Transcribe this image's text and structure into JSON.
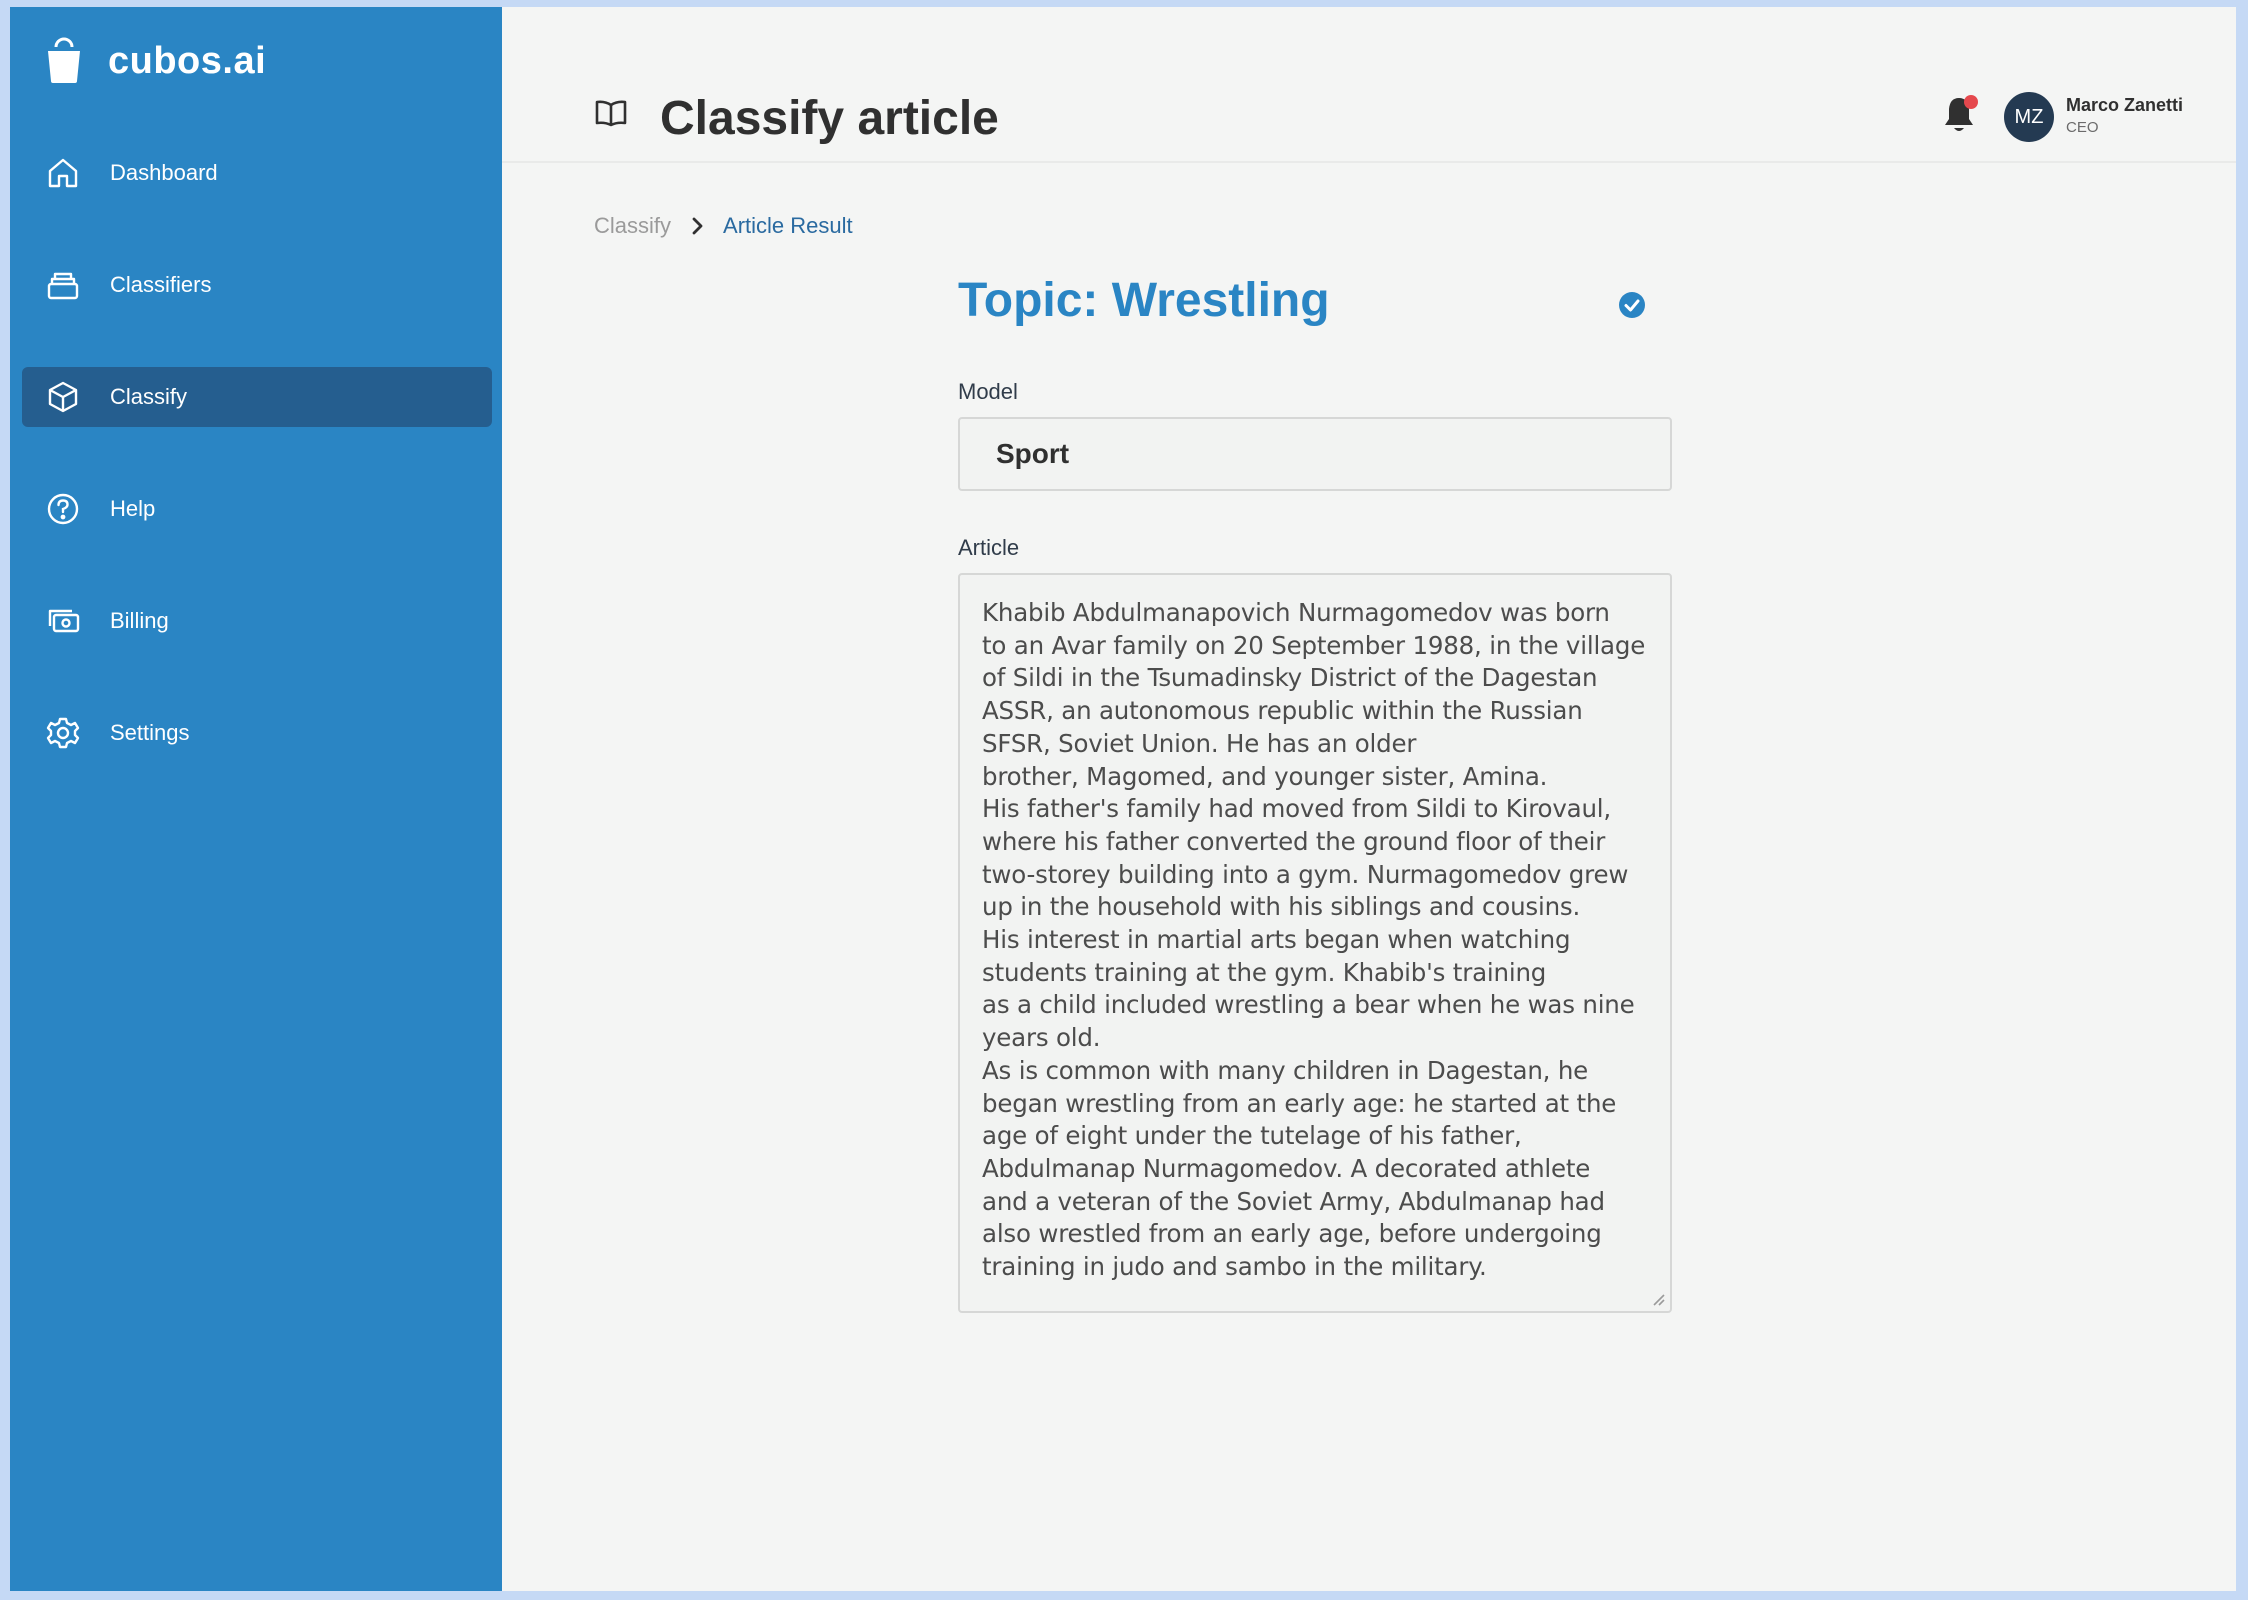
{
  "brand": {
    "name": "cubos.ai",
    "icon": "bucket-logo-icon"
  },
  "sidebar": {
    "items": [
      {
        "label": "Dashboard",
        "icon": "home-icon",
        "active": false
      },
      {
        "label": "Classifiers",
        "icon": "layers-icon",
        "active": false
      },
      {
        "label": "Classify",
        "icon": "cube-icon",
        "active": true
      },
      {
        "label": "Help",
        "icon": "help-circle-icon",
        "active": false
      },
      {
        "label": "Billing",
        "icon": "billing-icon",
        "active": false
      },
      {
        "label": "Settings",
        "icon": "gear-icon",
        "active": false
      }
    ]
  },
  "header": {
    "title": "Classify article",
    "icon": "book-icon",
    "notifications": {
      "icon": "bell-icon",
      "has_unread": true
    },
    "user": {
      "initials": "MZ",
      "name": "Marco Zanetti",
      "role": "CEO"
    }
  },
  "breadcrumb": {
    "items": [
      "Classify",
      "Article Result"
    ]
  },
  "result": {
    "topic": "Topic: Wrestling",
    "model_label": "Model",
    "model_value": "Sport",
    "article_label": "Article",
    "article_lines": [
      "Khabib Abdulmanapovich Nurmagomedov was born",
      "to an Avar family on 20 September 1988, in the village",
      "of Sildi in the Tsumadinsky District of the Dagestan",
      "ASSR, an autonomous republic within the Russian",
      "SFSR, Soviet Union. He has an older",
      "brother, Magomed, and younger sister, Amina.",
      "His father's family had moved from Sildi to Kirovaul,",
      "where his father converted the ground floor of their",
      "two-storey building into a gym. Nurmagomedov grew",
      "up in the household with his siblings and cousins.",
      "His interest in martial arts began when watching",
      "students training at the gym. Khabib's training",
      "as a child included wrestling a bear when he was nine",
      "years old.",
      "As is common with many children in Dagestan, he",
      "began wrestling from an early age: he started at the",
      "age of eight under the tutelage of his father,",
      "Abdulmanap Nurmagomedov. A decorated athlete",
      "and a veteran of the Soviet Army, Abdulmanap had",
      "also wrestled from an early age, before undergoing",
      "training in judo and sambo in the military."
    ]
  },
  "colors": {
    "sidebar": "#2a85c4",
    "sidebar_active": "#255e8f",
    "accent": "#2a85c4",
    "notification_dot": "#e5484d",
    "avatar_bg": "#243a52"
  }
}
